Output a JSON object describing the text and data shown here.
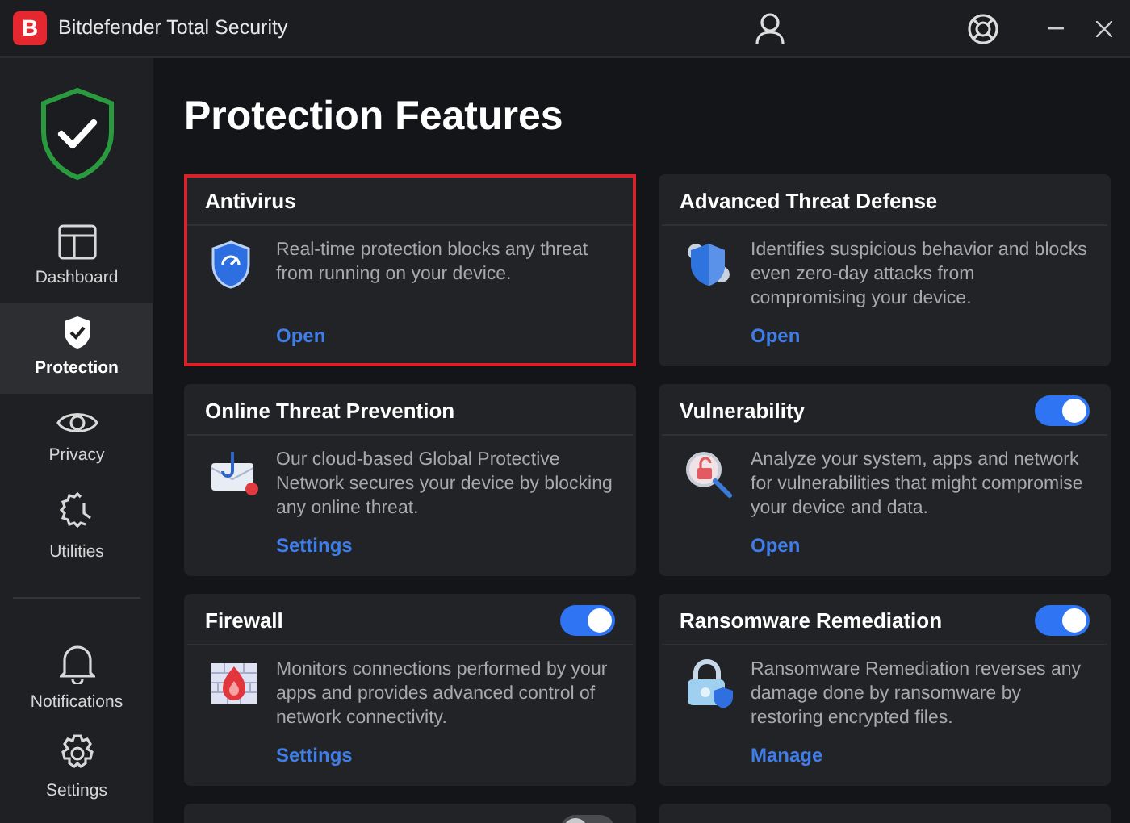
{
  "window": {
    "title": "Bitdefender Total Security",
    "logo": "B"
  },
  "sidebar": {
    "items": [
      {
        "label": "Dashboard",
        "selected": false
      },
      {
        "label": "Protection",
        "selected": true
      },
      {
        "label": "Privacy",
        "selected": false
      },
      {
        "label": "Utilities",
        "selected": false
      }
    ],
    "bottom_items": [
      {
        "label": "Notifications",
        "selected": false
      },
      {
        "label": "Settings",
        "selected": false
      }
    ]
  },
  "page_title": "Protection Features",
  "cards": [
    {
      "title": "Antivirus",
      "selected": true,
      "description": "Real-time protection blocks any threat from running on your device.",
      "link": "Open"
    },
    {
      "title": "Advanced Threat Defense",
      "selected": false,
      "description": "Identifies suspicious behavior and blocks even zero-day attacks from compromising your device.",
      "link": "Open"
    },
    {
      "title": "Online Threat Prevention",
      "selected": false,
      "description": "Our cloud-based Global Protective Network secures your device by blocking any online threat.",
      "link": "Settings"
    },
    {
      "title": "Vulnerability",
      "selected": false,
      "on": true,
      "description": "Analyze your system, apps and network for vulnerabilities that might compromise your device and data.",
      "link": "Open"
    },
    {
      "title": "Firewall",
      "selected": false,
      "on": true,
      "description": "Monitors connections performed by your apps and provides advanced control of network connectivity.",
      "link": "Settings"
    },
    {
      "title": "Ransomware Remediation",
      "selected": false,
      "on": true,
      "description": "Ransomware Remediation reverses any damage done by ransomware by restoring encrypted files.",
      "link": "Manage"
    },
    {
      "selected": false,
      "on": false
    },
    {
      "selected": false
    }
  ]
}
